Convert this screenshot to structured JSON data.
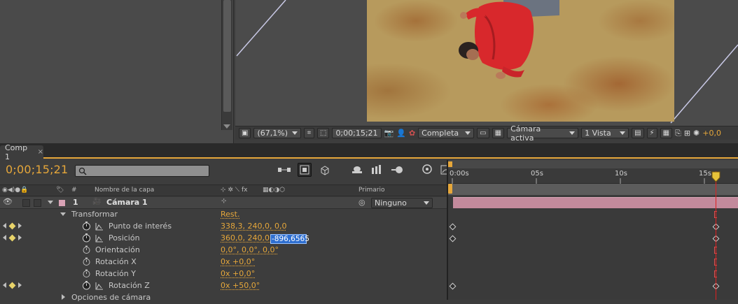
{
  "viewer": {
    "zoom": "(67,1%)",
    "timecode": "0;00;15;21",
    "resolution": "Completa",
    "camera": "Cámara activa",
    "views": "1 Vista",
    "exposure": "+0,0"
  },
  "tab": {
    "label": "Comp 1",
    "close": "×"
  },
  "timeline": {
    "timecode": "0;00;15;21",
    "search_placeholder": ""
  },
  "columns": {
    "hash": "#",
    "layer_name": "Nombre de la capa",
    "switches": "⊹ ✲ ⟍ fx",
    "parent": "Primario"
  },
  "layer": {
    "index": "1",
    "name": "Cámara 1",
    "parent": "Ninguno"
  },
  "rows": {
    "transform": "Transformar",
    "reset": "Rest.",
    "poi_label": "Punto de interés",
    "poi_value": "338,3, 240,0, 0,0",
    "pos_label": "Posición",
    "pos_value": "360,0, 240,0,",
    "pos_edit": "-896,6565",
    "orient_label": "Orientación",
    "orient_value": "0,0°, 0,0°, 0,0°",
    "rotx_label": "Rotación X",
    "rotx_value": "0x +0,0°",
    "roty_label": "Rotación Y",
    "roty_value": "0x +0,0°",
    "rotz_label": "Rotación Z",
    "rotz_value": "0x +50,0°",
    "cam_options": "Opciones de cámara"
  },
  "ruler": {
    "t0": "0:00s",
    "t5": "05s",
    "t10": "10s",
    "t15": "15s"
  },
  "colors": {
    "accent": "#e6a73a",
    "layer_label": "#d9a3b6",
    "layer_bar": "#c38a9c",
    "cti": "#e02020",
    "selection": "#2f6fd0"
  }
}
